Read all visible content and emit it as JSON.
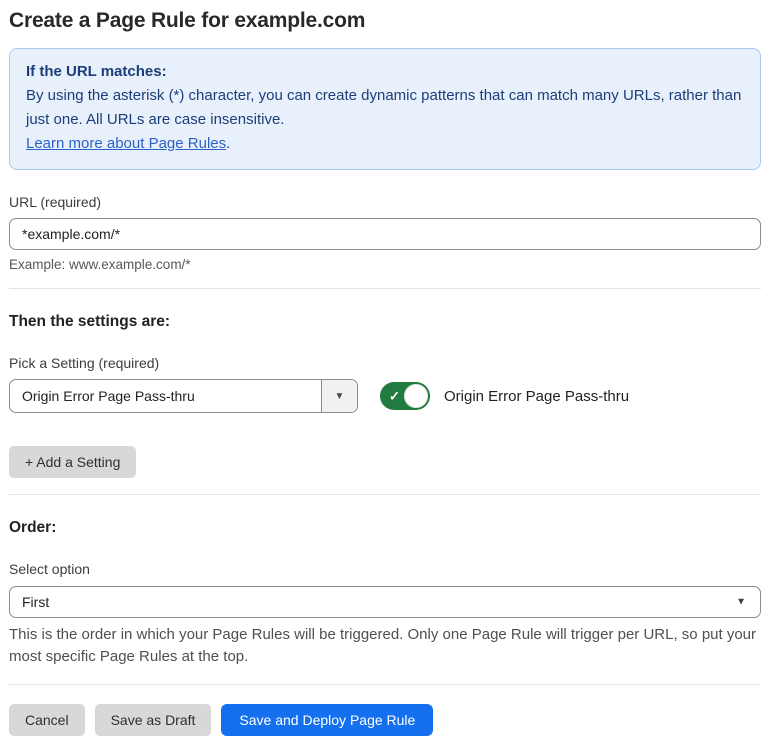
{
  "page": {
    "title": "Create a Page Rule for example.com"
  },
  "info_box": {
    "heading": "If the URL matches:",
    "body": "By using the asterisk (*) character, you can create dynamic patterns that can match many URLs, rather than just one. All URLs are case insensitive.",
    "link_label": "Learn more about Page Rules",
    "link_suffix": "."
  },
  "url_field": {
    "label": "URL (required)",
    "value": "*example.com/*",
    "helper": "Example: www.example.com/*"
  },
  "settings_section": {
    "heading": "Then the settings are:",
    "picker_label": "Pick a Setting (required)",
    "picker_value": "Origin Error Page Pass-thru",
    "toggle_state": "on",
    "toggle_label": "Origin Error Page Pass-thru",
    "add_button_label": "+ Add a Setting"
  },
  "order_section": {
    "heading": "Order:",
    "select_label": "Select option",
    "select_value": "First",
    "helper": "This is the order in which your Page Rules will be triggered. Only one Page Rule will trigger per URL, so put your most specific Page Rules at the top."
  },
  "footer": {
    "cancel_label": "Cancel",
    "save_draft_label": "Save as Draft",
    "save_deploy_label": "Save and Deploy Page Rule"
  },
  "icons": {
    "caret_down": "▼",
    "check": "✓"
  },
  "colors": {
    "info_bg": "#e8f1fb",
    "info_border": "#a9c9f0",
    "info_text": "#1c3d7a",
    "link_blue": "#2c62c8",
    "toggle_on_green": "#217a3e",
    "primary_button_blue": "#1570ef",
    "secondary_button_gray": "#d8d8d8"
  }
}
